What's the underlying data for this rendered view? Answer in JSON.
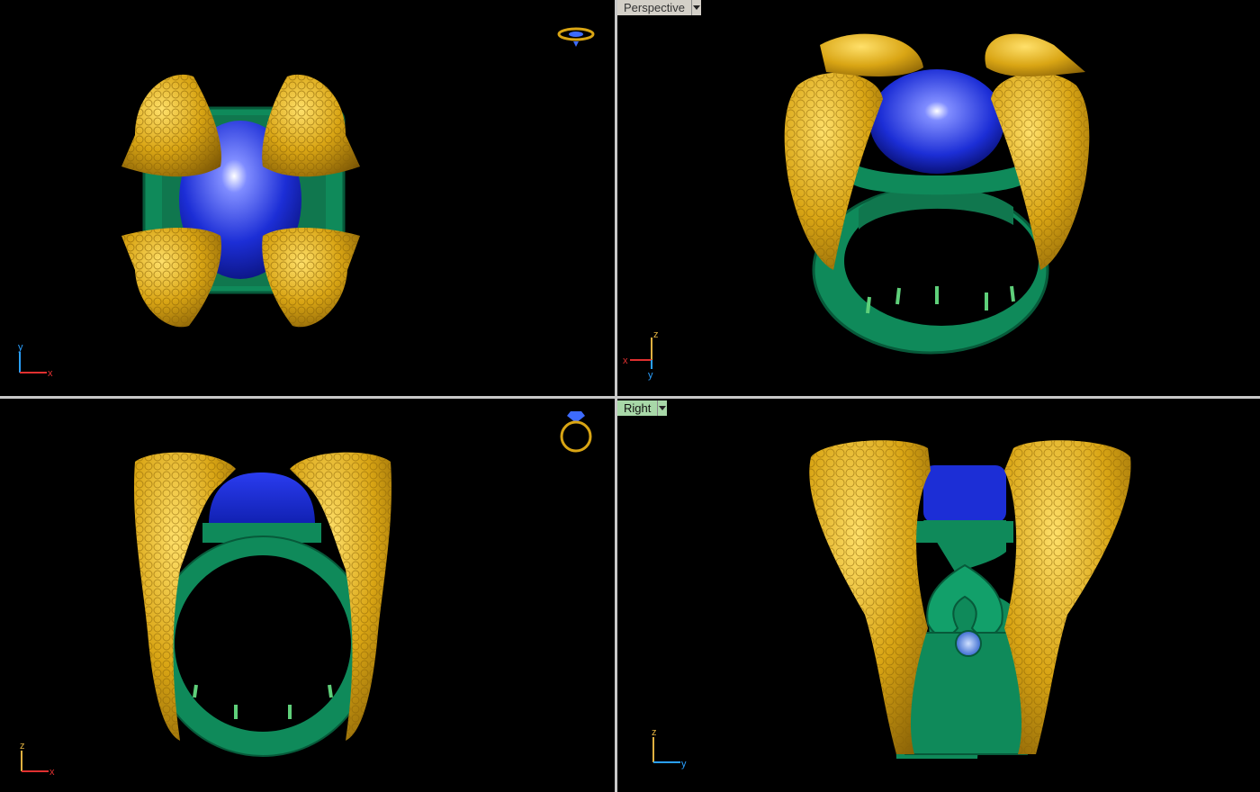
{
  "viewports": {
    "top": {
      "axis": {
        "v": "y",
        "h": "x"
      }
    },
    "perspective": {
      "title": "Perspective",
      "axis": {
        "v": "z",
        "h": "x",
        "d": "y"
      }
    },
    "front": {
      "axis": {
        "v": "z",
        "h": "x"
      }
    },
    "right": {
      "title": "Right",
      "axis": {
        "v": "z",
        "h": "y"
      }
    }
  },
  "colors": {
    "gold": "#d9a514",
    "gold_dark": "#8a6306",
    "green": "#0f8a5a",
    "green_dark": "#075a3a",
    "gem": "#1c2ed6",
    "gem_light": "#7f8cff",
    "axis_x": "#e03030",
    "axis_y": "#2aa0ff",
    "axis_z": "#e0b040",
    "divider": "#c8c8c8"
  },
  "icons": [
    "ring-top-icon",
    "ring-front-icon",
    "dropdown-arrow-icon"
  ]
}
